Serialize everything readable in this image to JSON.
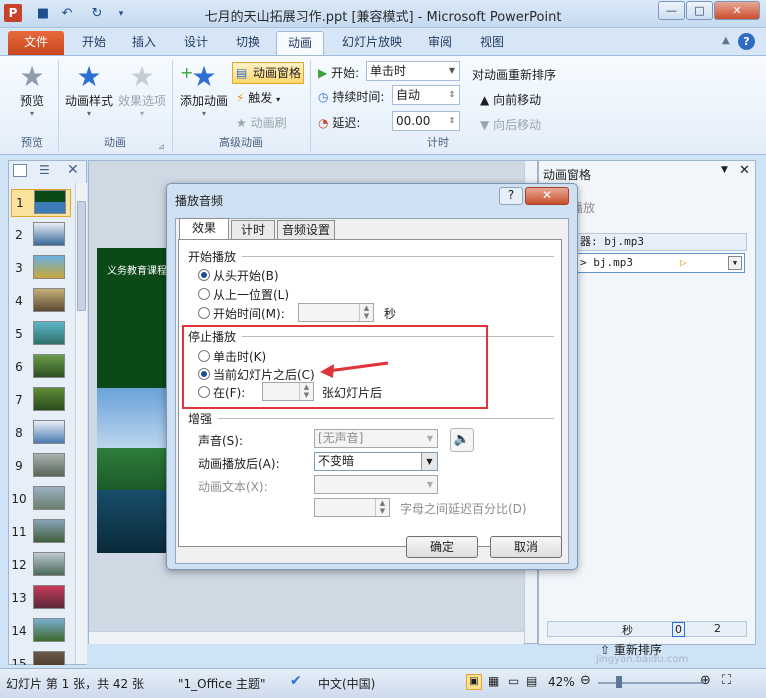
{
  "window": {
    "title": "七月的天山拓展习作.ppt [兼容模式] - Microsoft PowerPoint"
  },
  "tabs": [
    "文件",
    "开始",
    "插入",
    "设计",
    "切换",
    "动画",
    "幻灯片放映",
    "审阅",
    "视图"
  ],
  "ribbon": {
    "preview": {
      "btn": "预览",
      "group": "预览"
    },
    "animation": {
      "style": "动画样式",
      "effect_options": "效果选项",
      "group": "动画"
    },
    "advanced": {
      "add": "添加动画",
      "pane": "动画窗格",
      "trigger": "触发",
      "painter": "动画刷",
      "group": "高级动画"
    },
    "timing": {
      "start_label": "开始:",
      "start_value": "单击时",
      "duration_label": "持续时间:",
      "duration_value": "自动",
      "delay_label": "延迟:",
      "delay_value": "00.00",
      "reorder": "对动画重新排序",
      "move_earlier": "向前移动",
      "move_later": "向后移动",
      "group": "计时"
    }
  },
  "thumbnails": [
    "1",
    "2",
    "3",
    "4",
    "5",
    "6",
    "7",
    "8",
    "9",
    "10",
    "11",
    "12",
    "13",
    "14",
    "15"
  ],
  "slide": {
    "header_text": "义务教育课程"
  },
  "animation_pane": {
    "title": "动画窗格",
    "play_btn": "播放",
    "trigger_label": "器: bj.mp3",
    "item": "bj.mp3",
    "seconds_label": "秒",
    "timeline_0": "0",
    "timeline_2": "2",
    "reorder_label": "重新排序"
  },
  "dialog": {
    "title": "播放音频",
    "tabs": [
      "效果",
      "计时",
      "音频设置"
    ],
    "start_section": "开始播放",
    "start_options": [
      "从头开始(B)",
      "从上一位置(L)",
      "开始时间(M):"
    ],
    "start_time_unit": "秒",
    "stop_section": "停止播放",
    "stop_options": [
      "单击时(K)",
      "当前幻灯片之后(C)",
      "在(F):"
    ],
    "after_slides_unit": "张幻灯片后",
    "enhance_section": "增强",
    "sound_label": "声音(S):",
    "sound_value": "[无声音]",
    "after_anim_label": "动画播放后(A):",
    "after_anim_value": "不变暗",
    "anim_text_label": "动画文本(X):",
    "letter_delay_label": "字母之间延迟百分比(D)",
    "ok": "确定",
    "cancel": "取消"
  },
  "status": {
    "slide": "幻灯片 第 1 张，共 42 张",
    "theme": "\"1_Office 主题\"",
    "lang": "中文(中国)",
    "zoom": "42%"
  },
  "watermark": "jingyan.baidu.com",
  "colors": {
    "accent": "#1a4d9c",
    "highlight": "#e0333a",
    "file_tab": "#d4501f"
  }
}
